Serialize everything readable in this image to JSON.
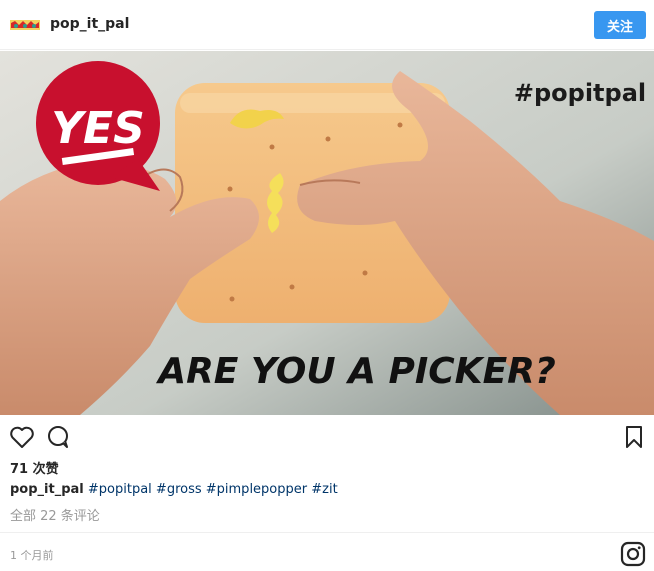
{
  "header": {
    "username": "pop_it_pal",
    "follow_label": "关注"
  },
  "photo": {
    "badge_text": "YES",
    "hashtag_overlay": "#popitpal",
    "headline": "ARE YOU A PICKER?"
  },
  "engagement": {
    "likes": "71 次赞"
  },
  "caption": {
    "username": "pop_it_pal",
    "tags": [
      "#popitpal",
      "#gross",
      "#pimplepopper",
      "#zit"
    ]
  },
  "comments": {
    "view_all": "全部 22 条评论"
  },
  "footer": {
    "timestamp": "1 个月前"
  },
  "icons": {
    "like": "heart-icon",
    "comment": "comment-icon",
    "save": "bookmark-icon",
    "brand": "instagram-icon"
  },
  "colors": {
    "accent": "#3897f0",
    "badge": "#c8102e"
  }
}
